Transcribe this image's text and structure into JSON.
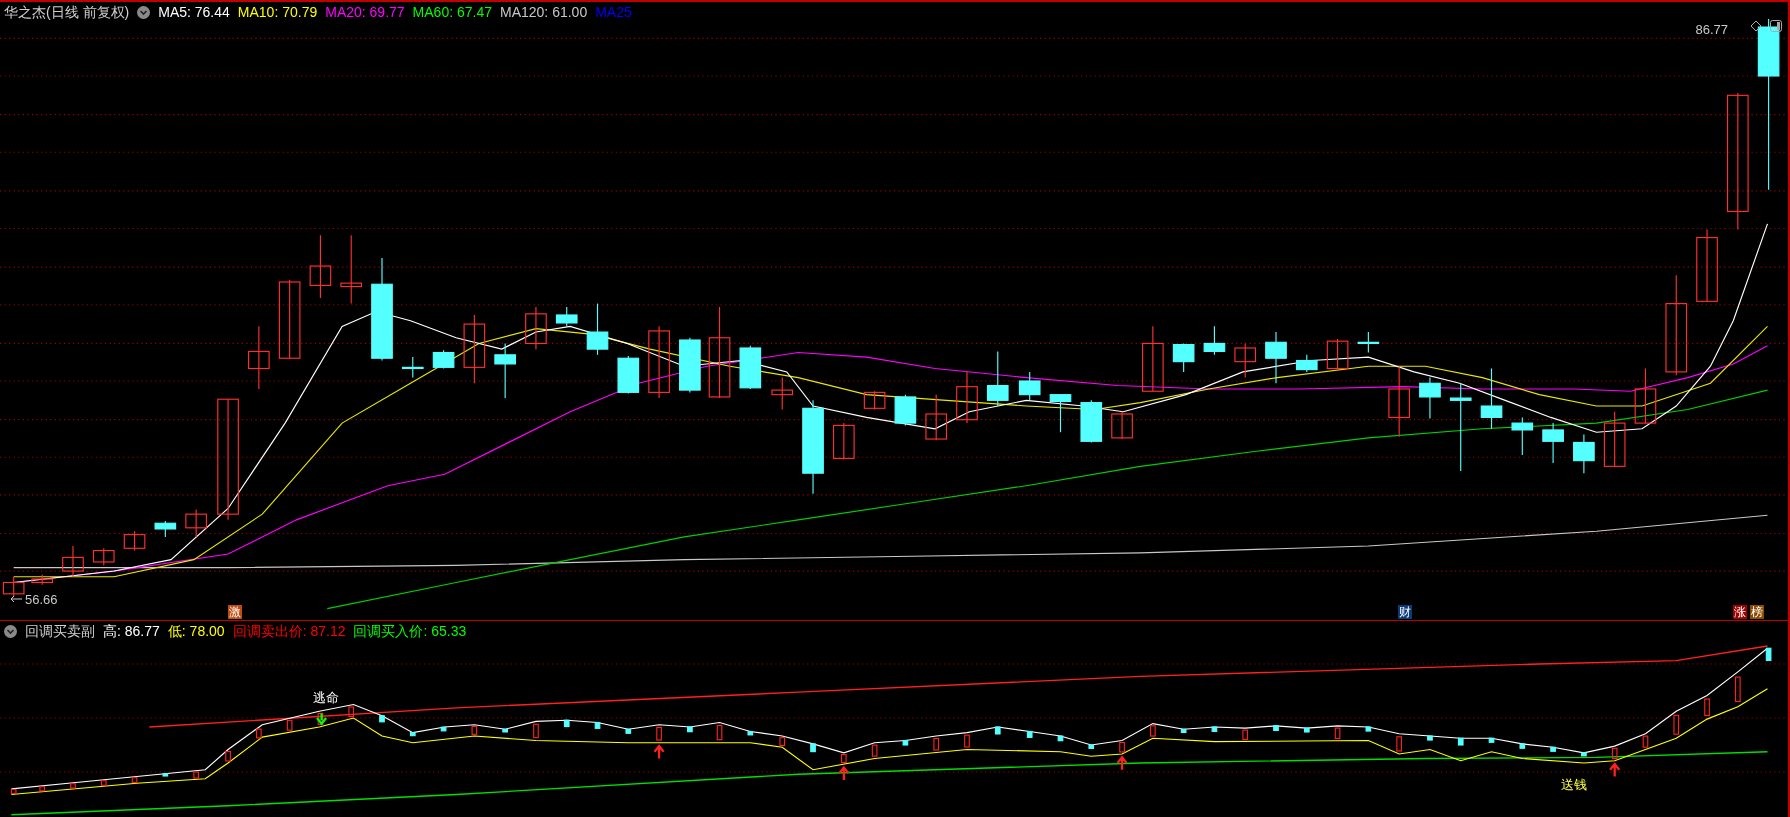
{
  "main_chart": {
    "title": "华之杰(日线 前复权)",
    "indicators": [
      {
        "label": "MA5: 76.44",
        "color": "#ffffff"
      },
      {
        "label": "MA10: 70.79",
        "color": "#ffff00"
      },
      {
        "label": "MA20: 69.77",
        "color": "#ff00ff"
      },
      {
        "label": "MA60: 67.47",
        "color": "#00ff00"
      },
      {
        "label": "MA120: 61.00",
        "color": "#c8c8c8"
      },
      {
        "label": "MA25",
        "color": "#0000ff"
      }
    ],
    "high_label": "86.77",
    "low_label": "56.66",
    "event_tags": [
      {
        "label": "激",
        "color": "#c04a10"
      },
      {
        "label": "财",
        "color": "#0a3a78"
      },
      {
        "label": "涨",
        "color": "#a00000"
      },
      {
        "label": "榜",
        "color": "#8a4a00"
      }
    ]
  },
  "sub_chart": {
    "title": "回调买卖副",
    "indicators": [
      {
        "label": "高: 86.77",
        "color": "#ffffff"
      },
      {
        "label": "低: 78.00",
        "color": "#ffff00"
      },
      {
        "label": "回调卖出价: 87.12",
        "color": "#ff0000"
      },
      {
        "label": "回调买入价: 65.33",
        "color": "#00ff00"
      }
    ],
    "signals": [
      {
        "label": "逃命",
        "kind": "sell"
      },
      {
        "label": "送钱",
        "kind": "buy"
      }
    ]
  }
}
